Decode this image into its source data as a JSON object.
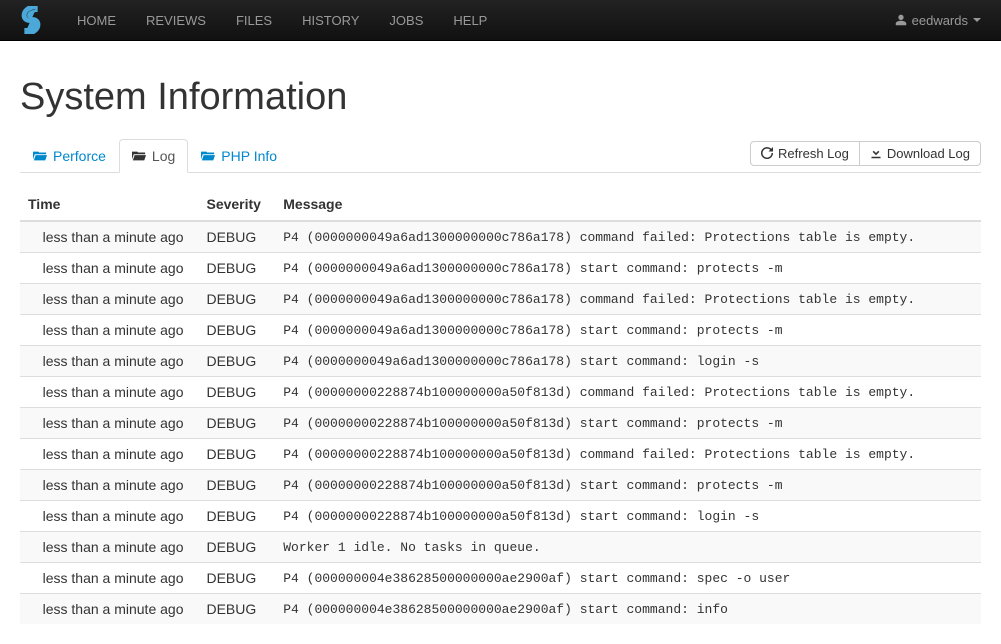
{
  "nav": {
    "items": [
      "HOME",
      "REVIEWS",
      "FILES",
      "HISTORY",
      "JOBS",
      "HELP"
    ],
    "user": "eedwards"
  },
  "page": {
    "title": "System Information"
  },
  "tabs": {
    "perforce": "Perforce",
    "log": "Log",
    "phpinfo": "PHP Info"
  },
  "buttons": {
    "refresh": "Refresh Log",
    "download": "Download Log"
  },
  "table": {
    "headers": {
      "time": "Time",
      "severity": "Severity",
      "message": "Message"
    },
    "rows": [
      {
        "time": "less than a minute ago",
        "severity": "DEBUG",
        "message": "P4 (0000000049a6ad1300000000c786a178) command failed: Protections table is empty."
      },
      {
        "time": "less than a minute ago",
        "severity": "DEBUG",
        "message": "P4 (0000000049a6ad1300000000c786a178) start command: protects -m"
      },
      {
        "time": "less than a minute ago",
        "severity": "DEBUG",
        "message": "P4 (0000000049a6ad1300000000c786a178) command failed: Protections table is empty."
      },
      {
        "time": "less than a minute ago",
        "severity": "DEBUG",
        "message": "P4 (0000000049a6ad1300000000c786a178) start command: protects -m"
      },
      {
        "time": "less than a minute ago",
        "severity": "DEBUG",
        "message": "P4 (0000000049a6ad1300000000c786a178) start command: login -s"
      },
      {
        "time": "less than a minute ago",
        "severity": "DEBUG",
        "message": "P4 (00000000228874b100000000a50f813d) command failed: Protections table is empty."
      },
      {
        "time": "less than a minute ago",
        "severity": "DEBUG",
        "message": "P4 (00000000228874b100000000a50f813d) start command: protects -m"
      },
      {
        "time": "less than a minute ago",
        "severity": "DEBUG",
        "message": "P4 (00000000228874b100000000a50f813d) command failed: Protections table is empty."
      },
      {
        "time": "less than a minute ago",
        "severity": "DEBUG",
        "message": "P4 (00000000228874b100000000a50f813d) start command: protects -m"
      },
      {
        "time": "less than a minute ago",
        "severity": "DEBUG",
        "message": "P4 (00000000228874b100000000a50f813d) start command: login -s"
      },
      {
        "time": "less than a minute ago",
        "severity": "DEBUG",
        "message": "Worker 1 idle. No tasks in queue."
      },
      {
        "time": "less than a minute ago",
        "severity": "DEBUG",
        "message": "P4 (000000004e38628500000000ae2900af) start command: spec -o user"
      },
      {
        "time": "less than a minute ago",
        "severity": "DEBUG",
        "message": "P4 (000000004e38628500000000ae2900af) start command: info"
      }
    ]
  }
}
